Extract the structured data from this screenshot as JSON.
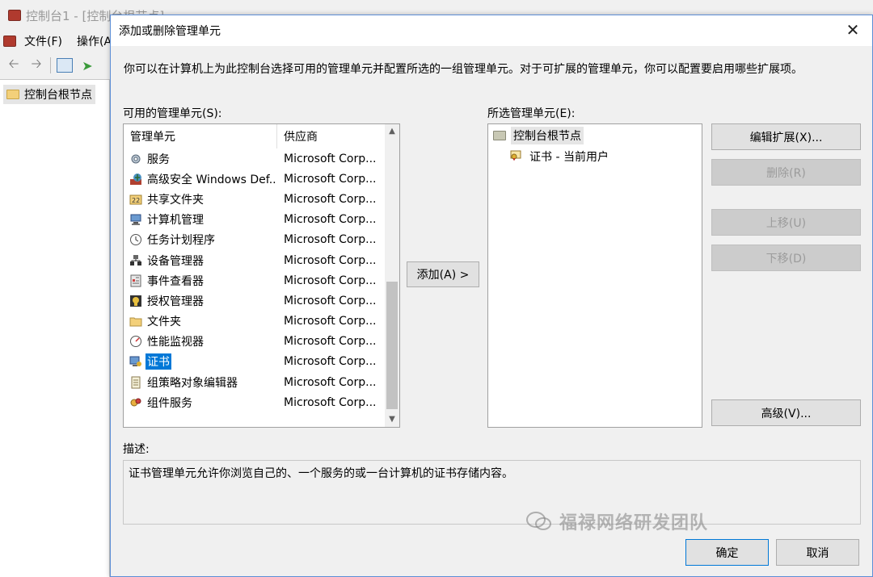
{
  "background_window": {
    "title": "控制台1 - [控制台根节点]",
    "menu": [
      "文件(F)",
      "操作(A"
    ],
    "tree_root": "控制台根节点"
  },
  "dialog": {
    "title": "添加或删除管理单元",
    "intro": "你可以在计算机上为此控制台选择可用的管理单元并配置所选的一组管理单元。对于可扩展的管理单元，你可以配置要启用哪些扩展项。",
    "available_label": "可用的管理单元(S):",
    "available_columns": [
      "管理单元",
      "供应商"
    ],
    "available_items": [
      {
        "name": "服务",
        "vendor": "Microsoft Corp...",
        "icon": "gear-icon"
      },
      {
        "name": "高级安全 Windows Def...",
        "vendor": "Microsoft Corp...",
        "icon": "firewall-icon"
      },
      {
        "name": "共享文件夹",
        "vendor": "Microsoft Corp...",
        "icon": "shared-folder-icon"
      },
      {
        "name": "计算机管理",
        "vendor": "Microsoft Corp...",
        "icon": "computer-management-icon"
      },
      {
        "name": "任务计划程序",
        "vendor": "Microsoft Corp...",
        "icon": "clock-icon"
      },
      {
        "name": "设备管理器",
        "vendor": "Microsoft Corp...",
        "icon": "device-manager-icon"
      },
      {
        "name": "事件查看器",
        "vendor": "Microsoft Corp...",
        "icon": "event-viewer-icon"
      },
      {
        "name": "授权管理器",
        "vendor": "Microsoft Corp...",
        "icon": "authorization-icon"
      },
      {
        "name": "文件夹",
        "vendor": "Microsoft Corp...",
        "icon": "folder-icon"
      },
      {
        "name": "性能监视器",
        "vendor": "Microsoft Corp...",
        "icon": "performance-icon"
      },
      {
        "name": "证书",
        "vendor": "Microsoft Corp...",
        "icon": "certificate-icon",
        "selected": true
      },
      {
        "name": "组策略对象编辑器",
        "vendor": "Microsoft Corp...",
        "icon": "policy-icon"
      },
      {
        "name": "组件服务",
        "vendor": "Microsoft Corp...",
        "icon": "component-services-icon"
      }
    ],
    "add_button": "添加(A) >",
    "selected_label": "所选管理单元(E):",
    "selected_root": "控制台根节点",
    "selected_child": "证书 - 当前用户",
    "buttons": {
      "edit_extensions": "编辑扩展(X)...",
      "remove": "删除(R)",
      "move_up": "上移(U)",
      "move_down": "下移(D)",
      "advanced": "高级(V)..."
    },
    "description_label": "描述:",
    "description": "证书管理单元允许你浏览自己的、一个服务的或一台计算机的证书存储内容。",
    "ok": "确定",
    "cancel": "取消"
  },
  "watermark": "福禄网络研发团队",
  "colors": {
    "selection": "#0078d7",
    "dialog_bg": "#f0f0f0",
    "border_accent": "#5c8ed6"
  }
}
